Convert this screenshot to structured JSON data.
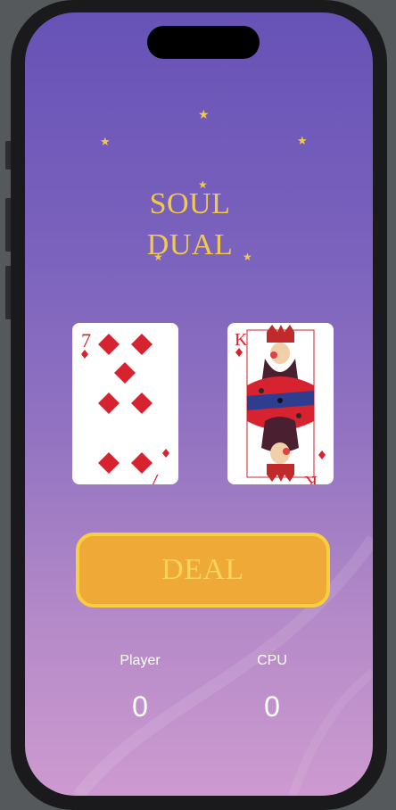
{
  "app": {
    "title_line1": "SOUL",
    "title_line2": "DUAL"
  },
  "cards": {
    "player": {
      "rank": "7",
      "suit": "diamonds",
      "pips": 7
    },
    "cpu": {
      "rank": "K",
      "suit": "diamonds",
      "face": "king"
    }
  },
  "action": {
    "deal_label": "DEAL"
  },
  "scores": {
    "player_label": "Player",
    "player_value": "0",
    "cpu_label": "CPU",
    "cpu_value": "0"
  },
  "colors": {
    "accent_gold": "#f2c94c",
    "button_fill": "#eea937",
    "button_border": "#f8cf3e",
    "card_red": "#d6232f",
    "bg_top": "#6752b6",
    "bg_bottom": "#cd9ad0"
  },
  "icons": [
    "star-icon",
    "moon-icon",
    "diamond-suit-icon"
  ]
}
